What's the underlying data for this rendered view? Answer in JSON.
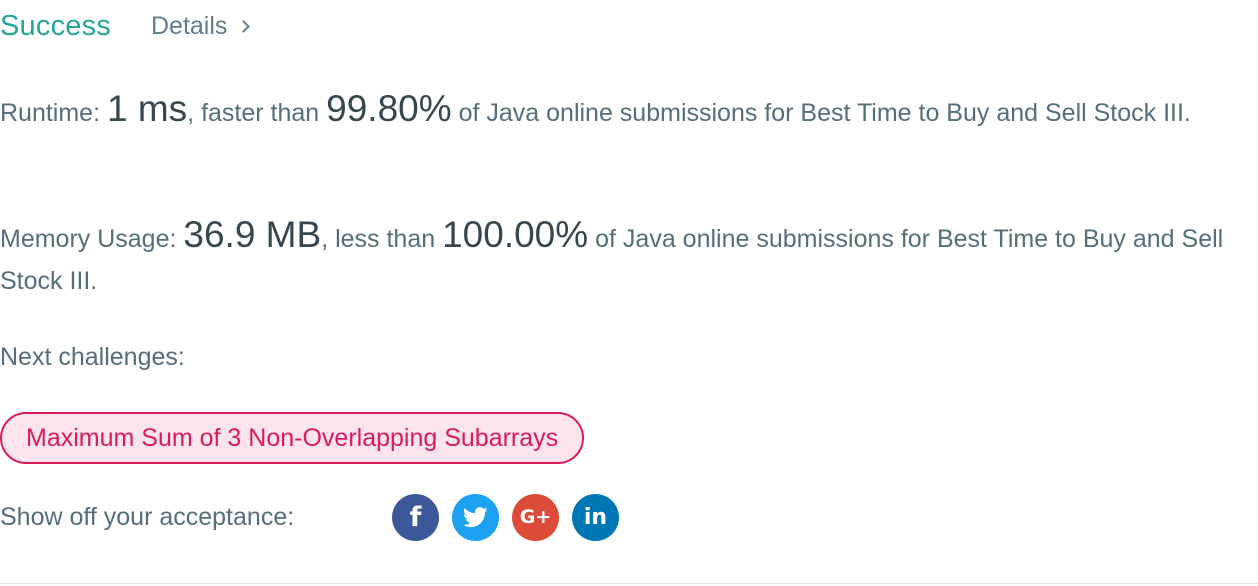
{
  "status": {
    "result_label": "Success",
    "details_label": "Details"
  },
  "runtime": {
    "prefix": "Runtime: ",
    "value": "1 ms",
    "middle": ", faster than ",
    "percent": "99.80%",
    "suffix": " of Java online submissions for Best Time to Buy and Sell Stock III."
  },
  "memory": {
    "prefix": "Memory Usage: ",
    "value": "36.9 MB",
    "middle": ", less than ",
    "percent": "100.00%",
    "suffix": " of Java online submissions for Best Time to Buy and Sell Stock III."
  },
  "next": {
    "label": "Next challenges:",
    "challenges": [
      "Maximum Sum of 3 Non-Overlapping Subarrays"
    ]
  },
  "share": {
    "label": "Show off your acceptance:",
    "icons": [
      "facebook-icon",
      "twitter-icon",
      "google-plus-icon",
      "linkedin-icon"
    ],
    "colors": {
      "facebook": "#3b5998",
      "twitter": "#1da1f2",
      "google_plus": "#dd4b39",
      "linkedin": "#0077b5"
    }
  },
  "colors": {
    "success": "#26a69a",
    "challenge_tag": "#d81b60",
    "challenge_tag_bg": "#fce4ec"
  }
}
